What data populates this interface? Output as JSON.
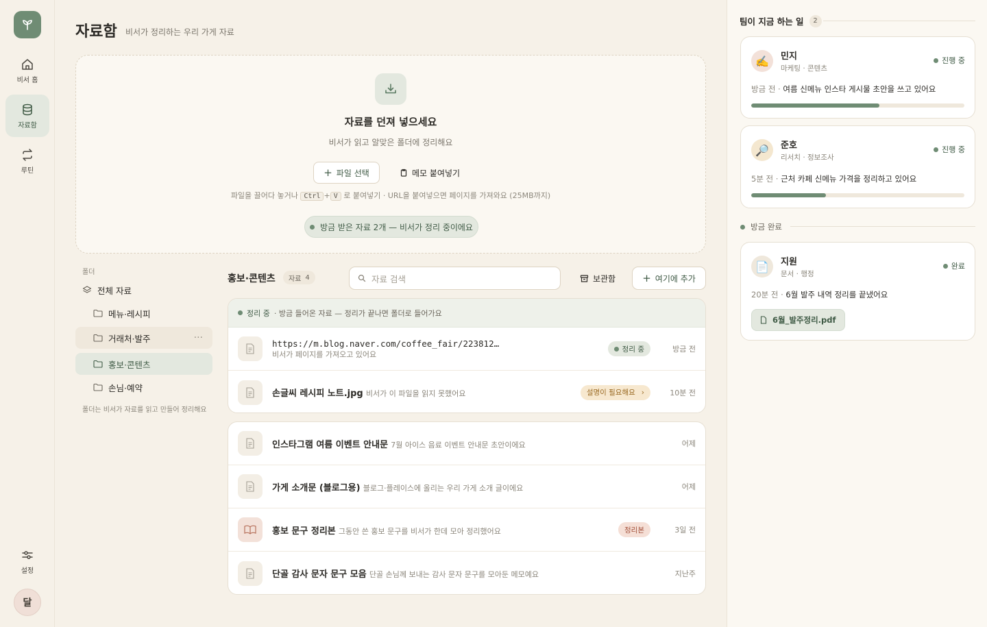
{
  "nav": {
    "items": [
      {
        "label": "비서 홈",
        "icon": "home-icon"
      },
      {
        "label": "자료함",
        "icon": "database-icon",
        "active": true
      },
      {
        "label": "루틴",
        "icon": "repeat-icon"
      }
    ],
    "settings_label": "설정",
    "avatar_text": "달"
  },
  "header": {
    "title": "자료함",
    "subtitle": "비서가 정리하는 우리 가게 자료"
  },
  "dropzone": {
    "title": "자료를 던져 넣으세요",
    "subtitle": "비서가 읽고 알맞은 폴더에 정리해요",
    "file_button": "파일 선택",
    "memo_button": "메모 붙여넣기",
    "hint_prefix": "파일을 끌어다 놓거나",
    "hint_key1": "Ctrl",
    "hint_plus": "+",
    "hint_key2": "V",
    "hint_suffix": "로 붙여넣기 · URL을 붙여넣으면 페이지를 가져와요 (25MB까지)",
    "status": "방금 받은 자료 2개 — 비서가 정리 중이에요"
  },
  "folders": {
    "caption": "폴더",
    "all_label": "전체 자료",
    "items": [
      "메뉴·레시피",
      "거래처·발주",
      "홍보·콘텐츠",
      "손님·예약"
    ],
    "more": "···",
    "note": "폴더는 비서가 자료를 읽고 만들어 정리해요"
  },
  "list": {
    "title": "홍보·콘텐츠",
    "count_label": "자료",
    "count": "4",
    "search_placeholder": "자료 검색",
    "archive_button": "보관함",
    "add_button": "여기에 추가",
    "processing": {
      "label": "정리 중",
      "text": "· 방금 들어온 자료 — 정리가 끝나면 폴더로 들어가요",
      "rows": [
        {
          "name": "https://m.blog.naver.com/coffee_fair/223812…",
          "desc": "비서가 페이지를 가져오고 있어요",
          "badge": "정리 중",
          "time": "방금 전"
        },
        {
          "name": "손글씨 레시피 노트.jpg",
          "desc": "비서가 이 파일을 읽지 못했어요",
          "badge": "설명이 필요해요",
          "badge_arrow": "›",
          "time": "10분 전"
        }
      ]
    },
    "rows": [
      {
        "name": "인스타그램 여름 이벤트 안내문",
        "desc": "7월 아이스 음료 이벤트 안내문 초안이에요",
        "time": "어제"
      },
      {
        "name": "가게 소개문 (블로그용)",
        "desc": "블로그·플레이스에 올리는 우리 가게 소개 글이에요",
        "time": "어제"
      },
      {
        "name": "홍보 문구 정리본",
        "desc": "그동안 쓴 홍보 문구를 비서가 한데 모아 정리했어요",
        "badge": "정리본",
        "time": "3일 전"
      },
      {
        "name": "단골 감사 문자 문구 모음",
        "desc": "단골 손님께 보내는 감사 문자 문구를 모아둔 메모예요",
        "time": "지난주"
      }
    ]
  },
  "team": {
    "caption": "팀이 지금 하는 일",
    "count": "2",
    "working": [
      {
        "avatar": "✍️",
        "name": "민지",
        "role": "마케팅 · 콘텐츠",
        "state": "진행 중",
        "when": "방금 전 ·",
        "message": "여름 신메뉴 인스타 게시물 초안을 쓰고 있어요",
        "progress": 0.6
      },
      {
        "avatar": "🔎",
        "name": "준호",
        "role": "리서치 · 정보조사",
        "state": "진행 중",
        "when": "5분 전 ·",
        "message": "근처 카페 신메뉴 가격을 정리하고 있어요",
        "progress": 0.35
      }
    ],
    "done_caption": "방금 완료",
    "done": {
      "avatar": "📄",
      "name": "지원",
      "role": "문서 · 행정",
      "state": "완료",
      "when": "20분 전 ·",
      "message": "6월 발주 내역 정리를 끝냈어요",
      "file": "6월_발주정리.pdf"
    }
  },
  "colors": {
    "accent": "#6f8c74",
    "background": "#f6f1e8",
    "amber": "#9a6a23",
    "red": "#a4533d"
  }
}
